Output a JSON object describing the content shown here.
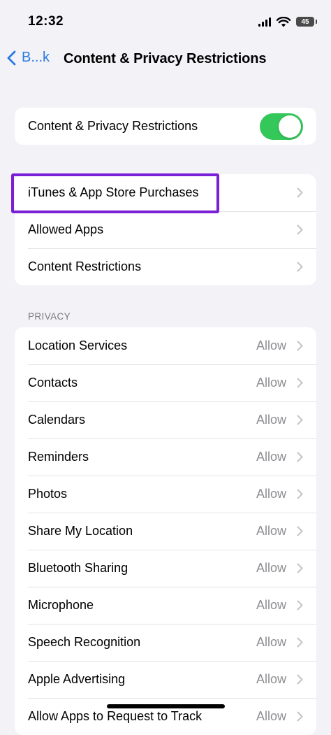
{
  "status_bar": {
    "time": "12:32",
    "battery_level": "45",
    "icons": [
      "signal-icon",
      "wifi-icon",
      "battery-icon"
    ]
  },
  "nav": {
    "back_label": "B...k",
    "title": "Content & Privacy Restrictions"
  },
  "master_toggle": {
    "label": "Content & Privacy Restrictions",
    "on": true,
    "color": "#34c759"
  },
  "main_section": {
    "items": [
      {
        "label": "iTunes & App Store Purchases",
        "highlighted": true
      },
      {
        "label": "Allowed Apps"
      },
      {
        "label": "Content Restrictions"
      }
    ]
  },
  "privacy_section": {
    "header": "PRIVACY",
    "items": [
      {
        "label": "Location Services",
        "value": "Allow"
      },
      {
        "label": "Contacts",
        "value": "Allow"
      },
      {
        "label": "Calendars",
        "value": "Allow"
      },
      {
        "label": "Reminders",
        "value": "Allow"
      },
      {
        "label": "Photos",
        "value": "Allow"
      },
      {
        "label": "Share My Location",
        "value": "Allow"
      },
      {
        "label": "Bluetooth Sharing",
        "value": "Allow"
      },
      {
        "label": "Microphone",
        "value": "Allow"
      },
      {
        "label": "Speech Recognition",
        "value": "Allow"
      },
      {
        "label": "Apple Advertising",
        "value": "Allow"
      },
      {
        "label": "Allow Apps to Request to Track",
        "value": "Allow"
      }
    ]
  },
  "colors": {
    "accent": "#2a7ae2",
    "toggle_on": "#34c759",
    "highlight": "#7a1fd6",
    "background": "#f2f2f7"
  }
}
